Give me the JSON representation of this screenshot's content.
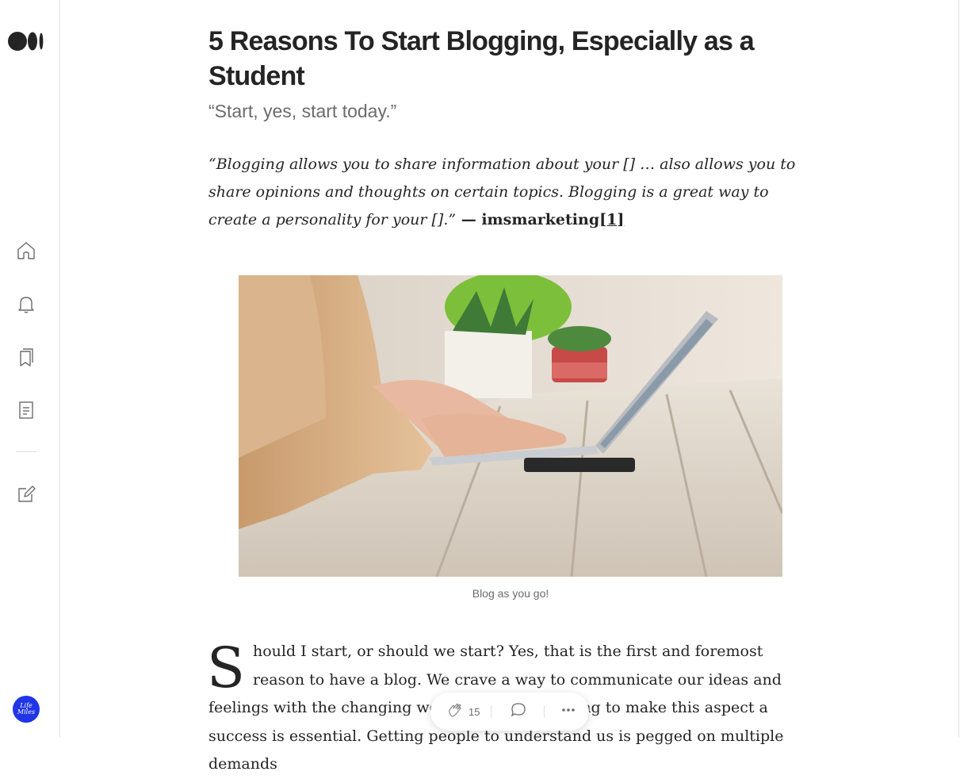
{
  "nav": {
    "logo": "medium-logo",
    "items": [
      {
        "name": "home",
        "icon": "home-icon"
      },
      {
        "name": "notifications",
        "icon": "bell-icon"
      },
      {
        "name": "lists",
        "icon": "bookmarks-icon"
      },
      {
        "name": "stories",
        "icon": "document-icon"
      },
      {
        "name": "write",
        "icon": "edit-icon"
      }
    ],
    "avatar_text": [
      "Life",
      "Miles"
    ]
  },
  "article": {
    "title": "5 Reasons To Start Blogging, Especially as a Student",
    "subtitle": "“Start, yes, start today.”",
    "quote": {
      "text": "“Blogging allows you to share information about your [] … also allows you to share opinions and thoughts on certain topics. Blogging is a great way to create a personality for your [].”",
      "source": " — imsmarketing",
      "ref": "[1]"
    },
    "image_caption": "Blog as you go!",
    "paragraph_dropcap": "S",
    "paragraph_text": "hould I start, or should we start? Yes, that is the first and foremost reason to have a blog. We crave a way to communicate our ideas and feelings with the changing world. As such, working to make this aspect a success is essential. Getting people to understand us is pegged on multiple demands"
  },
  "actions": {
    "clap_count": "15",
    "clap_icon": "clap-icon",
    "comment_icon": "comment-icon",
    "more_icon": "more-icon"
  },
  "colors": {
    "text": "#242424",
    "muted": "#6b6b6b",
    "avatar_bg": "#1f35e6"
  }
}
